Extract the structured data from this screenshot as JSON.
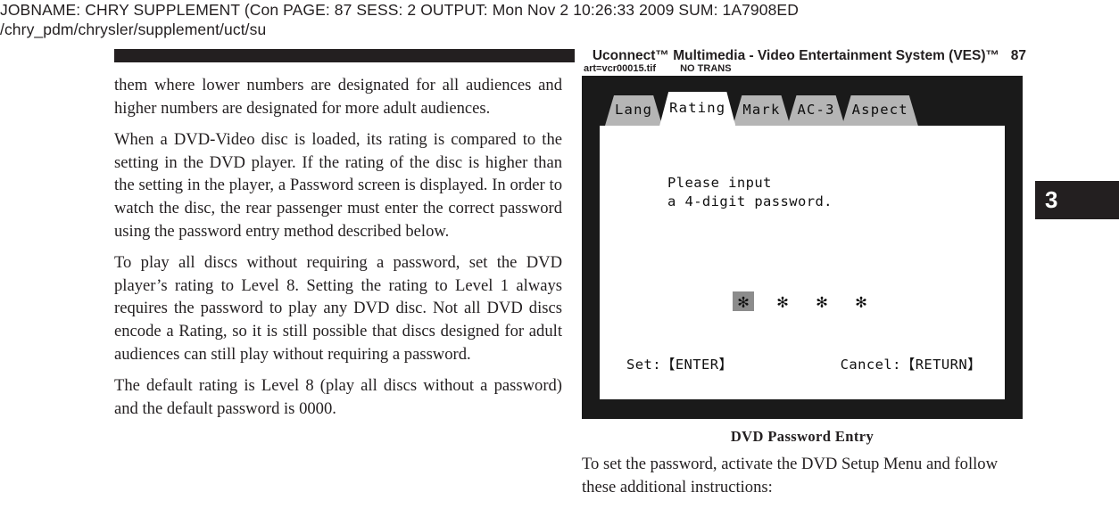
{
  "job_header": {
    "line1": "JOBNAME: CHRY SUPPLEMENT (Con  PAGE: 87  SESS: 2  OUTPUT: Mon Nov  2 10:26:33 2009  SUM: 1A7908ED",
    "line2": "/chry_pdm/chrysler/supplement/uct/su"
  },
  "running_head": {
    "title": "Uconnect™ Multimedia - Video Entertainment System (VES)™",
    "folio": "87"
  },
  "art_slug": {
    "file": "art=vcr00015.tif",
    "trans": "NO TRANS"
  },
  "left_column": {
    "paragraphs": [
      "them where lower numbers are designated for all audiences and higher numbers are designated for more adult audiences.",
      "When a DVD-Video disc is loaded, its rating is compared to the setting in the DVD player. If the rating of the disc is higher than the setting in the player, a Password screen is displayed. In order to watch the disc, the rear passenger must enter the correct password using the password entry method described below.",
      "To play all discs without requiring a password, set the DVD player’s rating to Level 8. Setting the rating to Level 1 always requires the password to play any DVD disc. Not all DVD discs encode a Rating, so it is still possible that discs designed for adult audiences can still play without requiring a password.",
      "The default rating is Level 8 (play all discs without a password) and the default password is 0000."
    ]
  },
  "dvd_screen": {
    "tabs": [
      {
        "label": "Lang",
        "active": false
      },
      {
        "label": "Rating",
        "active": true
      },
      {
        "label": "Mark",
        "active": false
      },
      {
        "label": "AC-3",
        "active": false
      },
      {
        "label": "Aspect",
        "active": false
      }
    ],
    "prompt": "Please input\na 4-digit password.",
    "password_chars": [
      {
        "glyph": "✻",
        "selected": true
      },
      {
        "glyph": "✻",
        "selected": false
      },
      {
        "glyph": "✻",
        "selected": false
      },
      {
        "glyph": "✻",
        "selected": false
      }
    ],
    "set_action": "Set:【ENTER】",
    "cancel_action": "Cancel:【RETURN】",
    "colors": {
      "bezel": "#1a1a1a",
      "screen": "#ffffff",
      "tab_inactive": "#b5b5b5",
      "tab_active": "#ffffff",
      "cursor_highlight": "#8c8c8c"
    }
  },
  "figure_caption": "DVD Password Entry",
  "right_column": {
    "paragraph": "To set the password, activate the DVD Setup Menu and follow these additional instructions:"
  },
  "chapter_tab": {
    "number": "3"
  }
}
